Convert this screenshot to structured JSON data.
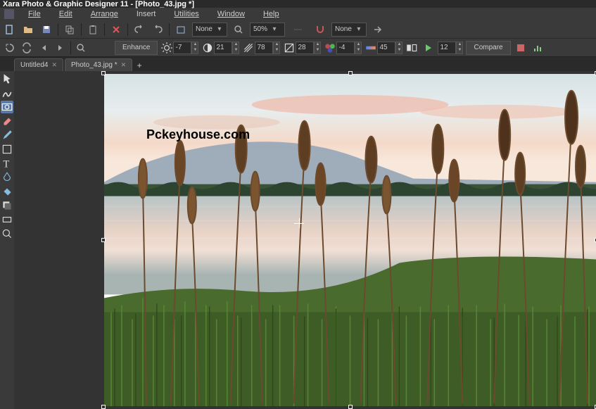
{
  "window": {
    "title": "Xara Photo & Graphic Designer 11 - [Photo_43.jpg *]"
  },
  "menu": {
    "file": "File",
    "edit": "Edit",
    "arrange": "Arrange",
    "insert": "Insert",
    "utilities": "Utilities",
    "window": "Window",
    "help": "Help"
  },
  "toolbar1": {
    "quality": "None",
    "zoom": "50%",
    "snap": "None"
  },
  "toolbar2": {
    "enhance": "Enhance",
    "brightness": "-7",
    "contrast": "21",
    "saturation": "78",
    "sharpness": "28",
    "hue": "-4",
    "temp": "45",
    "noise": "12",
    "compare": "Compare"
  },
  "tabs": [
    {
      "label": "Untitled4",
      "active": false
    },
    {
      "label": "Photo_43.jpg *",
      "active": true
    }
  ],
  "watermark": "Pckeyhouse.com"
}
